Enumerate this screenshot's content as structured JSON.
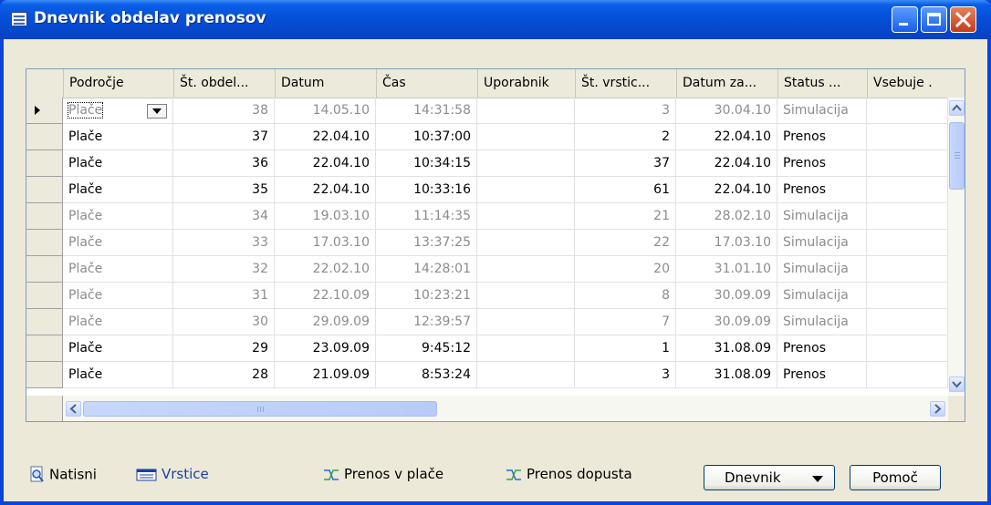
{
  "window": {
    "title": "Dnevnik obdelav prenosov"
  },
  "columns": [
    "Področje",
    "Št. obdel...",
    "Datum",
    "Čas",
    "Uporabnik",
    "Št. vrstic...",
    "Datum za...",
    "Status ...",
    "Vsebuje ."
  ],
  "rows": [
    {
      "podrocje": "Plače",
      "st": "38",
      "datum": "14.05.10",
      "cas": "14:31:58",
      "uporabnik": "",
      "vrstic": "3",
      "datum_za": "30.04.10",
      "status": "Simulacija",
      "vsebuje": ""
    },
    {
      "podrocje": "Plače",
      "st": "37",
      "datum": "22.04.10",
      "cas": "10:37:00",
      "uporabnik": "",
      "vrstic": "2",
      "datum_za": "22.04.10",
      "status": "Prenos",
      "vsebuje": ""
    },
    {
      "podrocje": "Plače",
      "st": "36",
      "datum": "22.04.10",
      "cas": "10:34:15",
      "uporabnik": "",
      "vrstic": "37",
      "datum_za": "22.04.10",
      "status": "Prenos",
      "vsebuje": ""
    },
    {
      "podrocje": "Plače",
      "st": "35",
      "datum": "22.04.10",
      "cas": "10:33:16",
      "uporabnik": "",
      "vrstic": "61",
      "datum_za": "22.04.10",
      "status": "Prenos",
      "vsebuje": ""
    },
    {
      "podrocje": "Plače",
      "st": "34",
      "datum": "19.03.10",
      "cas": "11:14:35",
      "uporabnik": "",
      "vrstic": "21",
      "datum_za": "28.02.10",
      "status": "Simulacija",
      "vsebuje": ""
    },
    {
      "podrocje": "Plače",
      "st": "33",
      "datum": "17.03.10",
      "cas": "13:37:25",
      "uporabnik": "",
      "vrstic": "22",
      "datum_za": "17.03.10",
      "status": "Simulacija",
      "vsebuje": ""
    },
    {
      "podrocje": "Plače",
      "st": "32",
      "datum": "22.02.10",
      "cas": "14:28:01",
      "uporabnik": "",
      "vrstic": "20",
      "datum_za": "31.01.10",
      "status": "Simulacija",
      "vsebuje": ""
    },
    {
      "podrocje": "Plače",
      "st": "31",
      "datum": "22.10.09",
      "cas": "10:23:21",
      "uporabnik": "",
      "vrstic": "8",
      "datum_za": "30.09.09",
      "status": "Simulacija",
      "vsebuje": ""
    },
    {
      "podrocje": "Plače",
      "st": "30",
      "datum": "29.09.09",
      "cas": "12:39:57",
      "uporabnik": "",
      "vrstic": "7",
      "datum_za": "30.09.09",
      "status": "Simulacija",
      "vsebuje": ""
    },
    {
      "podrocje": "Plače",
      "st": "29",
      "datum": "23.09.09",
      "cas": "9:45:12",
      "uporabnik": "",
      "vrstic": "1",
      "datum_za": "31.08.09",
      "status": "Prenos",
      "vsebuje": ""
    },
    {
      "podrocje": "Plače",
      "st": "28",
      "datum": "21.09.09",
      "cas": "8:53:24",
      "uporabnik": "",
      "vrstic": "3",
      "datum_za": "31.08.09",
      "status": "Prenos",
      "vsebuje": ""
    }
  ],
  "actions": {
    "natisni": "Natisni",
    "vrstice": "Vrstice",
    "prenos_place": "Prenos v plače",
    "prenos_dopusta": "Prenos dopusta"
  },
  "buttons": {
    "dnevnik": "Dnevnik",
    "pomoc": "Pomoč"
  },
  "colors": {
    "title_bar": "#0550d8",
    "simulation_text": "#8c8c8c",
    "transfer_text": "#000000",
    "link_text": "#1a3fa8"
  }
}
